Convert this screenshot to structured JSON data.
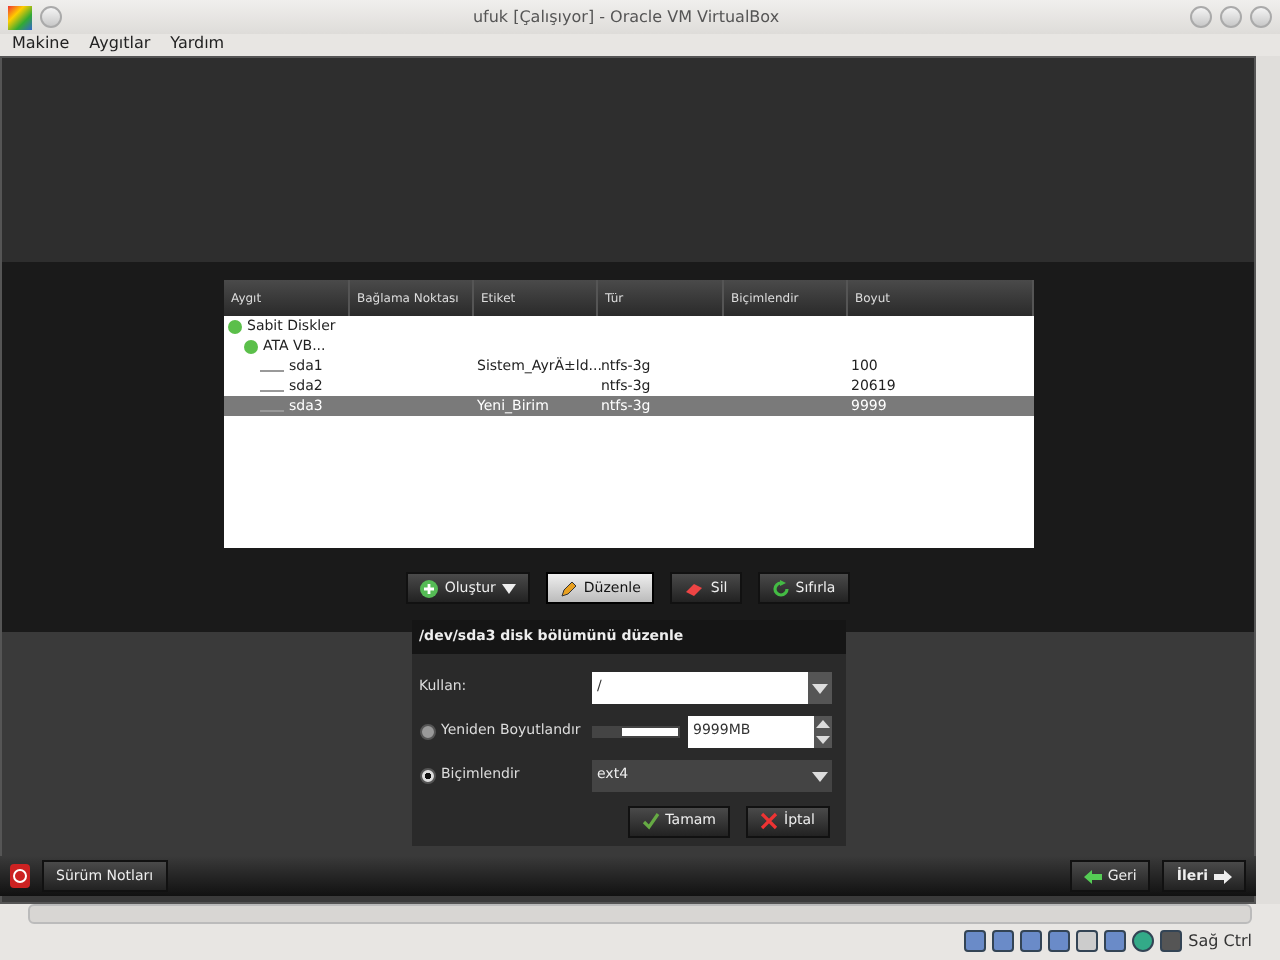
{
  "window": {
    "title": "ufuk [Çalışıyor] - Oracle VM VirtualBox"
  },
  "menu": [
    "Makine",
    "Aygıtlar",
    "Yardım"
  ],
  "table": {
    "columns": [
      "Aygıt",
      "Bağlama Noktası",
      "Etiket",
      "Tür",
      "Biçimlendir",
      "Boyut"
    ],
    "rows": [
      {
        "device": "Sabit Diskler",
        "expanded": true,
        "selected": false,
        "children": [
          {
            "device": "ATA VB...",
            "expanded": true,
            "selected": false,
            "children": [
              {
                "device": "sda1",
                "label": "Sistem_AyrÄ±ld...",
                "type": "ntfs-3g",
                "size": "100",
                "selected": false
              },
              {
                "device": "sda2",
                "type": "ntfs-3g",
                "size": "20619",
                "selected": false
              },
              {
                "device": "sda3",
                "label": "Yeni_Birim",
                "type": "ntfs-3g",
                "size": "9999",
                "selected": true
              }
            ]
          }
        ]
      }
    ]
  },
  "toolbar": [
    {
      "label": "Oluştur",
      "kind": "create",
      "dropdown": true,
      "selected": false
    },
    {
      "label": "Düzenle",
      "kind": "edit",
      "dropdown": false,
      "selected": true
    },
    {
      "label": "Sil",
      "kind": "delete",
      "dropdown": false,
      "selected": false
    },
    {
      "label": "Sıfırla",
      "kind": "reset",
      "dropdown": false,
      "selected": false
    }
  ],
  "edit_panel": {
    "title": "/dev/sda3 disk bölümünü düzenle",
    "use": {
      "label": "Kullan:",
      "value": "/"
    },
    "resize": {
      "label": "Yeniden Boyutlandır",
      "selected": false,
      "level": 0.35,
      "value": "9999MB"
    },
    "format": {
      "label": "Biçimlendir",
      "selected": true,
      "value": "ext4"
    },
    "buttons": [
      {
        "label": "Tamam",
        "kind": "ok"
      },
      {
        "label": "İptal",
        "kind": "cancel"
      }
    ]
  },
  "bottom_bar": {
    "release_notes": "Sürüm Notları",
    "back": "Geri",
    "next": "İleri"
  },
  "status_bar": {
    "host_key": "Sağ Ctrl"
  }
}
